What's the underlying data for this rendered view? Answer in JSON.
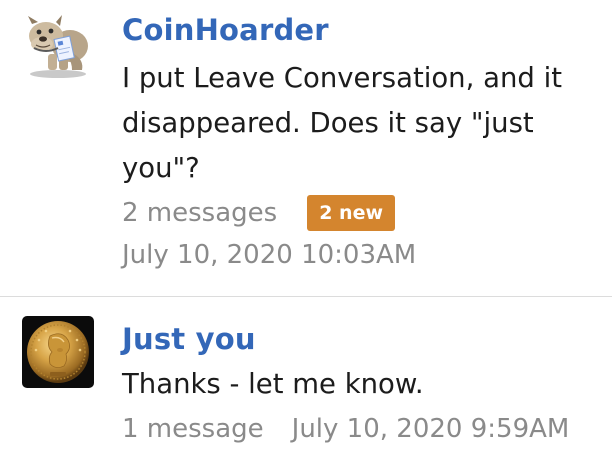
{
  "conversations": [
    {
      "username": "CoinHoarder",
      "avatar_icon": "bulldog-holding-envelope-avatar",
      "preview": "I put Leave Conversation, and it disappeared. Does it say \"just you\"?",
      "message_count": "2 messages",
      "new_badge": "2 new",
      "timestamp": "July 10, 2020 10:03AM"
    },
    {
      "username": "Just you",
      "avatar_icon": "gold-coin-avatar",
      "preview": "Thanks - let me know.",
      "message_count": "1 message",
      "timestamp": "July 10, 2020 9:59AM"
    }
  ],
  "colors": {
    "username": "#3367b8",
    "badge": "#d4852e",
    "meta": "#8a8a8a",
    "text": "#1c1c1c",
    "divider": "#dcdcdc"
  }
}
